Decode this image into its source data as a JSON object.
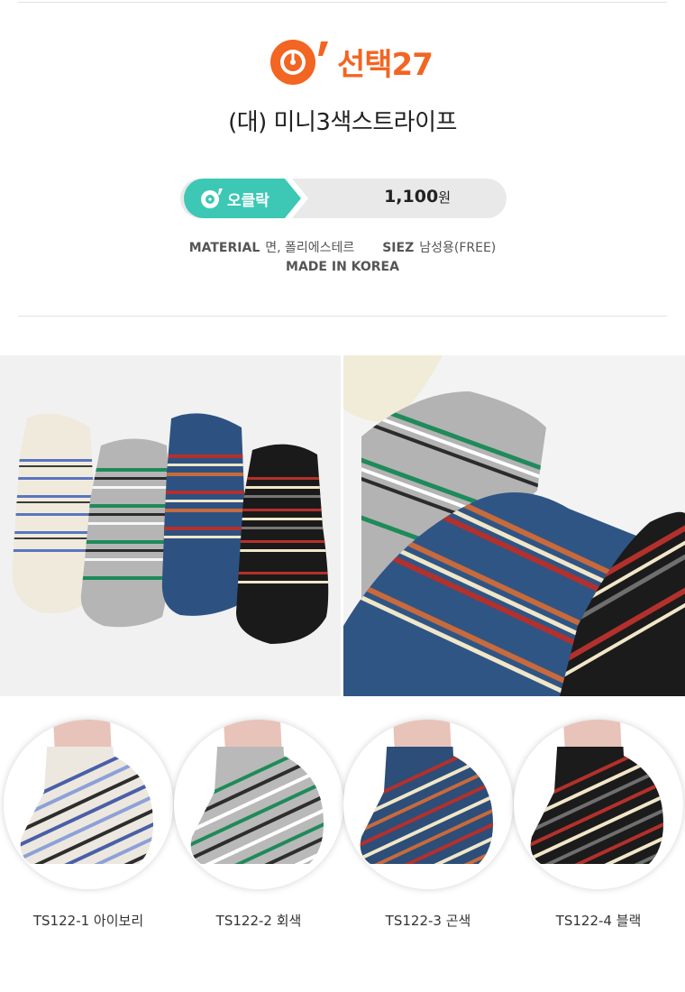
{
  "brand": {
    "name": "선택27",
    "logo_color": "#f26522"
  },
  "product": {
    "title": "(대) 미니3색스트라이프"
  },
  "price": {
    "tag_label": "오클락",
    "tag_color": "#3cc8b4",
    "amount": "1,100",
    "unit": "원"
  },
  "specs": {
    "material_label": "MATERIAL",
    "material_value": "면, 폴리에스테르",
    "size_label": "SIEZ",
    "size_value": "남성용(FREE)",
    "origin": "MADE IN KOREA"
  },
  "photos": {
    "left": {
      "icon": "four-socks-flatlay-image"
    },
    "right": {
      "icon": "socks-closeup-image"
    }
  },
  "variants": [
    {
      "caption": "TS122-1 아이보리",
      "base": "#ece8df",
      "stripes": [
        "#4a5fa8",
        "#8da0d8",
        "#2d2d2d"
      ]
    },
    {
      "caption": "TS122-2 회색",
      "base": "#b9b9b9",
      "stripes": [
        "#1f8a5a",
        "#2d2d2d",
        "#ffffff"
      ]
    },
    {
      "caption": "TS122-3 곤색",
      "base": "#2c4e78",
      "stripes": [
        "#b4302c",
        "#f1e6c8",
        "#c86a3c"
      ]
    },
    {
      "caption": "TS122-4 블랙",
      "base": "#1b1b1b",
      "stripes": [
        "#b4302c",
        "#f1e6c8",
        "#6f6f6f"
      ]
    }
  ]
}
